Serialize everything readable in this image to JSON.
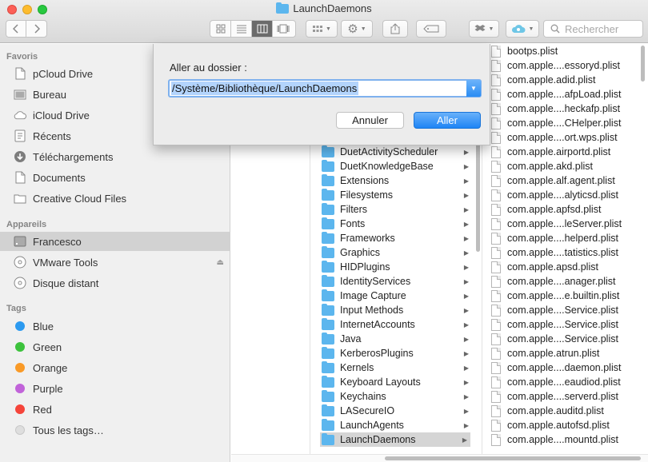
{
  "window": {
    "title": "LaunchDaemons"
  },
  "toolbar": {
    "search_placeholder": "Rechercher"
  },
  "sidebar": {
    "favorites_heading": "Favoris",
    "favorites": [
      {
        "label": "pCloud Drive",
        "icon": "document-icon"
      },
      {
        "label": "Bureau",
        "icon": "desktop-icon"
      },
      {
        "label": "iCloud Drive",
        "icon": "cloud-icon"
      },
      {
        "label": "Récents",
        "icon": "recents-icon"
      },
      {
        "label": "Téléchargements",
        "icon": "download-icon"
      },
      {
        "label": "Documents",
        "icon": "document-icon"
      },
      {
        "label": "Creative Cloud Files",
        "icon": "folder-icon"
      }
    ],
    "devices_heading": "Appareils",
    "devices": [
      {
        "label": "Francesco",
        "icon": "drive-icon",
        "selected": true
      },
      {
        "label": "VMware Tools",
        "icon": "disc-icon"
      },
      {
        "label": "Disque distant",
        "icon": "disc-icon"
      }
    ],
    "tags_heading": "Tags",
    "tags": [
      {
        "label": "Blue",
        "color": "#2c9af0"
      },
      {
        "label": "Green",
        "color": "#3cc23c"
      },
      {
        "label": "Orange",
        "color": "#f99a27"
      },
      {
        "label": "Purple",
        "color": "#c163d9"
      },
      {
        "label": "Red",
        "color": "#f5443a"
      },
      {
        "label": "Tous les tags…",
        "color": "#dedede"
      }
    ]
  },
  "folders_column": [
    {
      "label": "DuetActivityScheduler"
    },
    {
      "label": "DuetKnowledgeBase"
    },
    {
      "label": "Extensions"
    },
    {
      "label": "Filesystems"
    },
    {
      "label": "Filters"
    },
    {
      "label": "Fonts"
    },
    {
      "label": "Frameworks"
    },
    {
      "label": "Graphics"
    },
    {
      "label": "HIDPlugins"
    },
    {
      "label": "IdentityServices"
    },
    {
      "label": "Image Capture"
    },
    {
      "label": "Input Methods"
    },
    {
      "label": "InternetAccounts"
    },
    {
      "label": "Java"
    },
    {
      "label": "KerberosPlugins"
    },
    {
      "label": "Kernels"
    },
    {
      "label": "Keyboard Layouts"
    },
    {
      "label": "Keychains"
    },
    {
      "label": "LASecureIO"
    },
    {
      "label": "LaunchAgents"
    },
    {
      "label": "LaunchDaemons",
      "selected": true
    }
  ],
  "files_column": [
    "bootps.plist",
    "com.apple....essoryd.plist",
    "com.apple.adid.plist",
    "com.apple....afpLoad.plist",
    "com.apple....heckafp.plist",
    "com.apple....CHelper.plist",
    "com.apple....ort.wps.plist",
    "com.apple.airportd.plist",
    "com.apple.akd.plist",
    "com.apple.alf.agent.plist",
    "com.apple....alyticsd.plist",
    "com.apple.apfsd.plist",
    "com.apple....leServer.plist",
    "com.apple....helperd.plist",
    "com.apple....tatistics.plist",
    "com.apple.apsd.plist",
    "com.apple....anager.plist",
    "com.apple....e.builtin.plist",
    "com.apple....Service.plist",
    "com.apple....Service.plist",
    "com.apple....Service.plist",
    "com.apple.atrun.plist",
    "com.apple....daemon.plist",
    "com.apple....eaudiod.plist",
    "com.apple....serverd.plist",
    "com.apple.auditd.plist",
    "com.apple.autofsd.plist",
    "com.apple....mountd.plist"
  ],
  "go_to_folder": {
    "label": "Aller au dossier :",
    "path": "/Système/Bibliothèque/LaunchDaemons",
    "cancel_label": "Annuler",
    "go_label": "Aller"
  }
}
